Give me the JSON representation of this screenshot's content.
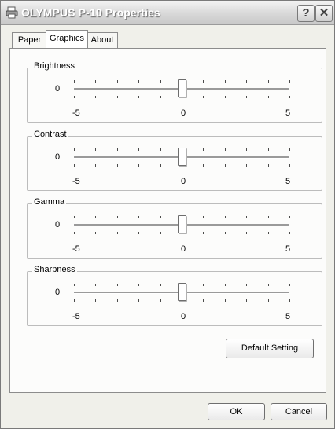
{
  "window": {
    "title": "OLYMPUS P-10 Properties",
    "help_label": "?",
    "close_label": "✕"
  },
  "tabs": [
    {
      "label": "Paper",
      "active": false
    },
    {
      "label": "Graphics",
      "active": true
    },
    {
      "label": "About",
      "active": false
    }
  ],
  "sliders": [
    {
      "label": "Brightness",
      "value": 0,
      "min_label": "-5",
      "mid_label": "0",
      "max_label": "5",
      "min": -5,
      "max": 5,
      "tick_count": 11
    },
    {
      "label": "Contrast",
      "value": 0,
      "min_label": "-5",
      "mid_label": "0",
      "max_label": "5",
      "min": -5,
      "max": 5,
      "tick_count": 11
    },
    {
      "label": "Gamma",
      "value": 0,
      "min_label": "-5",
      "mid_label": "0",
      "max_label": "5",
      "min": -5,
      "max": 5,
      "tick_count": 11
    },
    {
      "label": "Sharpness",
      "value": 0,
      "min_label": "-5",
      "mid_label": "0",
      "max_label": "5",
      "min": -5,
      "max": 5,
      "tick_count": 11
    }
  ],
  "buttons": {
    "default_setting": "Default Setting",
    "ok": "OK",
    "cancel": "Cancel"
  }
}
